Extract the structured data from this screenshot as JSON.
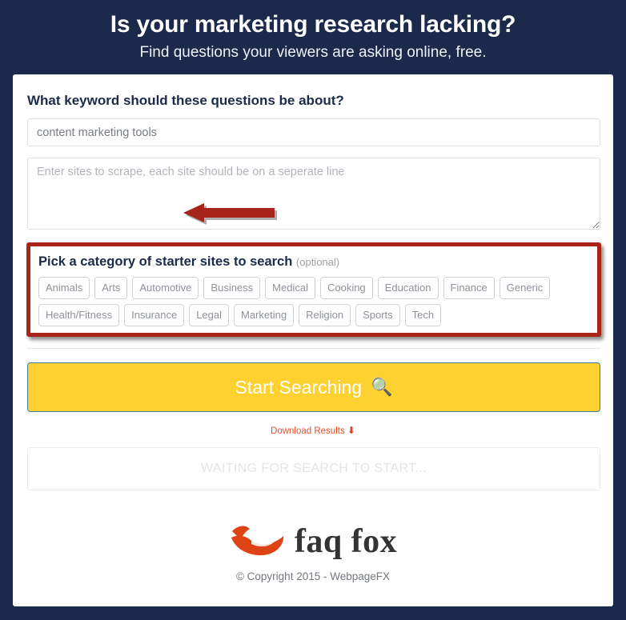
{
  "header": {
    "title": "Is your marketing research lacking?",
    "subtitle": "Find questions your viewers are asking online, free."
  },
  "form": {
    "keyword_label": "What keyword should these questions be about?",
    "keyword_value": "content marketing tools",
    "keyword_placeholder": "content marketing tools",
    "sites_placeholder": "Enter sites to scrape, each site should be on a seperate line",
    "sites_value": ""
  },
  "categories": {
    "heading": "Pick a category of starter sites to search",
    "optional_note": "(optional)",
    "tags": [
      "Animals",
      "Arts",
      "Automotive",
      "Business",
      "Medical",
      "Cooking",
      "Education",
      "Finance",
      "Generic",
      "Health/Fitness",
      "Insurance",
      "Legal",
      "Marketing",
      "Religion",
      "Sports",
      "Tech"
    ]
  },
  "actions": {
    "search_button_label": "Start Searching",
    "search_icon": "search-icon",
    "download_label": "Download Results",
    "download_icon": "arrow-down-icon"
  },
  "status": {
    "text": "WAITING FOR SEARCH TO START..."
  },
  "footer": {
    "logo_icon": "fox-logo-icon",
    "logo_text": "faq fox",
    "copyright": "© Copyright 2015 - WebpageFX"
  },
  "annotations": {
    "arrow_icon": "red-arrow-left-icon",
    "highlight_box": "red-highlight-box"
  },
  "colors": {
    "page_background": "#1b2a4a",
    "card_background": "#ffffff",
    "accent_yellow": "#fdd130",
    "annotation_red": "#aa2318",
    "link_orange": "#ea4b2a",
    "logo_orange": "#dd4314"
  }
}
